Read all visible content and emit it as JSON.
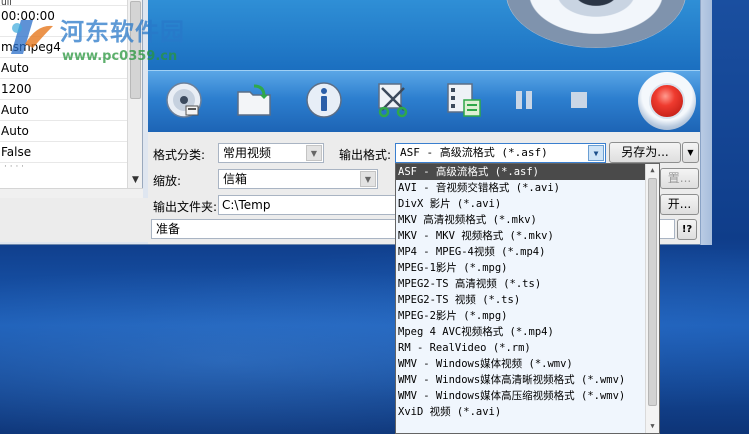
{
  "watermark": {
    "title": "河东软件园",
    "url": "www.pc0359.cn"
  },
  "left_list": {
    "rows": [
      "ull",
      "00:00:00",
      "msmpeg4",
      "Auto",
      "1200",
      "Auto",
      "Auto",
      "False"
    ],
    "more": "· · · ·"
  },
  "toolbar": {
    "icons": [
      "cd-disc-icon",
      "open-folder-icon",
      "info-icon",
      "cut-clip-icon",
      "film-settings-icon",
      "pause-icon",
      "stop-icon",
      "record-icon"
    ]
  },
  "form": {
    "format_category_label": "格式分类:",
    "format_category_value": "常用视频",
    "output_format_label": "输出格式:",
    "output_format_value": "ASF - 高级流格式  (*.asf)",
    "save_as_button": "另存为...",
    "zoom_label": "缩放:",
    "zoom_value": "信箱",
    "settings_button_partial": "置...",
    "output_folder_label": "输出文件夹:",
    "output_folder_value": "C:\\Temp",
    "open_button_partial": "开...",
    "status_text": "准备",
    "help_button": "!?"
  },
  "dropdown": {
    "selected_index": 0,
    "options": [
      "ASF - 高级流格式  (*.asf)",
      "AVI - 音视频交错格式  (*.avi)",
      "DivX 影片  (*.avi)",
      "MKV 高清视频格式  (*.mkv)",
      "MKV - MKV 视频格式  (*.mkv)",
      "MP4 - MPEG-4视频  (*.mp4)",
      "MPEG-1影片  (*.mpg)",
      "MPEG2-TS 高清视频  (*.ts)",
      "MPEG2-TS 视频  (*.ts)",
      "MPEG-2影片  (*.mpg)",
      "Mpeg 4 AVC视频格式  (*.mp4)",
      "RM - RealVideo  (*.rm)",
      "WMV - Windows媒体视频  (*.wmv)",
      "WMV - Windows媒体高清晰视频格式  (*.wmv)",
      "WMV - Windows媒体高压缩视频格式  (*.wmv)",
      "XviD 视频  (*.avi)"
    ]
  },
  "colors": {
    "toolbar_blue": "#2d7fcf",
    "record_red": "#ef3b2f",
    "selected_row": "#4a4a4a",
    "desktop_blue": "#1a4fa0"
  }
}
